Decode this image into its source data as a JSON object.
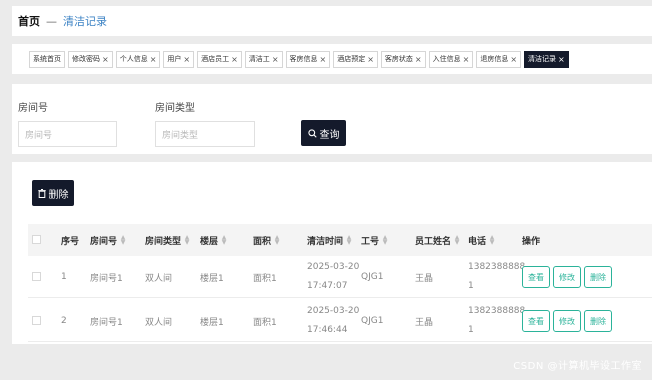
{
  "breadcrumb": {
    "home": "首页",
    "separator": "—",
    "current": "清洁记录"
  },
  "tags": [
    {
      "label": "系统首页",
      "closable": false,
      "active": false
    },
    {
      "label": "修改密码",
      "closable": true,
      "active": false
    },
    {
      "label": "个人信息",
      "closable": true,
      "active": false
    },
    {
      "label": "用户",
      "closable": true,
      "active": false
    },
    {
      "label": "酒店员工",
      "closable": true,
      "active": false
    },
    {
      "label": "清洁工",
      "closable": true,
      "active": false
    },
    {
      "label": "客房信息",
      "closable": true,
      "active": false
    },
    {
      "label": "酒店预定",
      "closable": true,
      "active": false
    },
    {
      "label": "客房状态",
      "closable": true,
      "active": false
    },
    {
      "label": "入住信息",
      "closable": true,
      "active": false
    },
    {
      "label": "退房信息",
      "closable": true,
      "active": false
    },
    {
      "label": "清洁记录",
      "closable": true,
      "active": true
    }
  ],
  "close_glyph": "×",
  "search": {
    "room_no_label": "房间号",
    "room_no_placeholder": "房间号",
    "room_type_label": "房间类型",
    "room_type_placeholder": "房间类型",
    "query_button": "查询",
    "query_icon": "search-icon"
  },
  "toolbar": {
    "delete_button": "删除",
    "delete_icon": "trash-icon"
  },
  "table": {
    "columns": [
      "序号",
      "房间号",
      "房间类型",
      "楼层",
      "面积",
      "清洁时间",
      "工号",
      "员工姓名",
      "电话",
      "操作"
    ],
    "rows": [
      {
        "index": "1",
        "room_no": "房间号1",
        "room_type": "双人间",
        "floor": "楼层1",
        "area": "面积1",
        "time_line1": "2025-03-20",
        "time_line2": "17:47:07",
        "staff_id": "QJG1",
        "staff_name": "王晶",
        "phone_line1": "1382388888",
        "phone_line2": "1"
      },
      {
        "index": "2",
        "room_no": "房间号1",
        "room_type": "双人间",
        "floor": "楼层1",
        "area": "面积1",
        "time_line1": "2025-03-20",
        "time_line2": "17:46:44",
        "staff_id": "QJG1",
        "staff_name": "王晶",
        "phone_line1": "1382388888",
        "phone_line2": "1"
      }
    ],
    "actions": {
      "view": "查看",
      "edit": "修改",
      "delete": "删除"
    }
  },
  "watermark": "CSDN @计算机毕设工作室",
  "colors": {
    "dark": "#141a2b",
    "accent_green": "#2bb39a",
    "link_blue": "#3b82c4"
  }
}
